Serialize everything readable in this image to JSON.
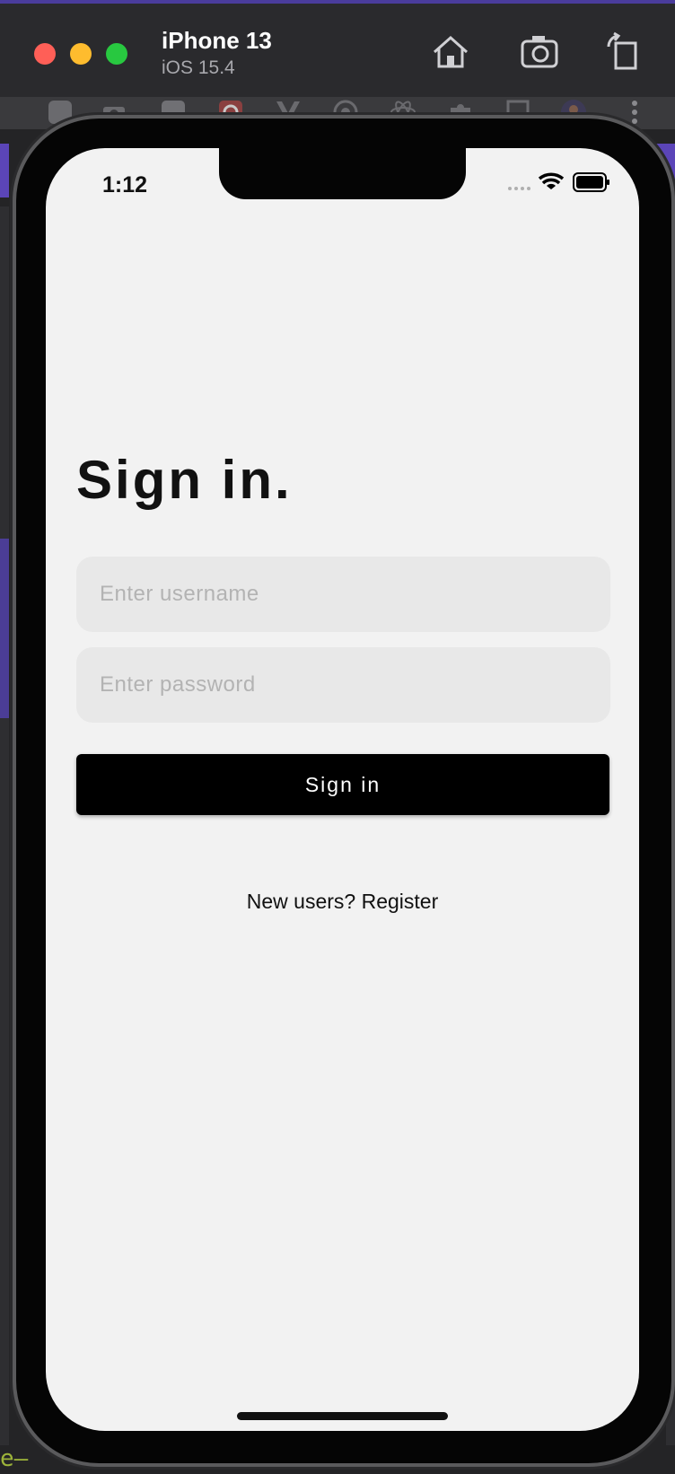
{
  "simulator": {
    "device_name": "iPhone 13",
    "os_version": "iOS 15.4",
    "toolbar_icons": [
      "home-icon",
      "screenshot-icon",
      "rotate-icon"
    ],
    "traffic_light_colors": [
      "#ff5f57",
      "#febc2e",
      "#28c840"
    ]
  },
  "status_bar": {
    "time": "1:12",
    "icons": [
      "signal-icon",
      "wifi-icon",
      "battery-icon"
    ]
  },
  "screen": {
    "title": "Sign in.",
    "username_placeholder": "Enter username",
    "password_placeholder": "Enter password",
    "signin_label": "Sign in",
    "register_text": "New users? Register"
  },
  "background": {
    "corner_text": "e–"
  },
  "colors": {
    "screen_bg": "#f2f2f2",
    "field_bg": "#e8e8e8",
    "button_bg": "#000000",
    "button_text": "#ffffff",
    "accent_purple": "#5b45b8"
  }
}
